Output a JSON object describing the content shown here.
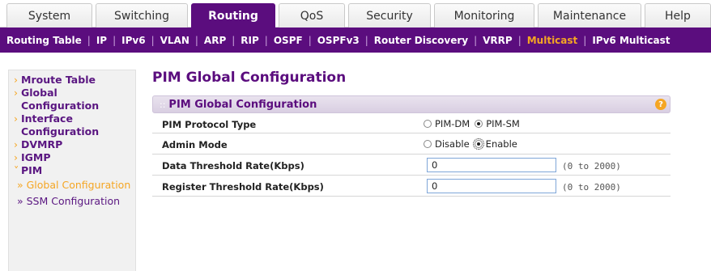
{
  "top_tabs": [
    {
      "label": "System",
      "active": false
    },
    {
      "label": "Switching",
      "active": false
    },
    {
      "label": "Routing",
      "active": true
    },
    {
      "label": "QoS",
      "active": false
    },
    {
      "label": "Security",
      "active": false
    },
    {
      "label": "Monitoring",
      "active": false
    },
    {
      "label": "Maintenance",
      "active": false
    },
    {
      "label": "Help",
      "active": false
    }
  ],
  "sub_nav": [
    {
      "label": "Routing Table",
      "active": false
    },
    {
      "label": "IP",
      "active": false
    },
    {
      "label": "IPv6",
      "active": false
    },
    {
      "label": "VLAN",
      "active": false
    },
    {
      "label": "ARP",
      "active": false
    },
    {
      "label": "RIP",
      "active": false
    },
    {
      "label": "OSPF",
      "active": false
    },
    {
      "label": "OSPFv3",
      "active": false
    },
    {
      "label": "Router Discovery",
      "active": false
    },
    {
      "label": "VRRP",
      "active": false
    },
    {
      "label": "Multicast",
      "active": true
    },
    {
      "label": "IPv6 Multicast",
      "active": false
    }
  ],
  "sidebar": {
    "items": [
      {
        "bullet": "›",
        "label": "Mroute Table"
      },
      {
        "bullet": "›",
        "label": "Global Configuration"
      },
      {
        "bullet": "›",
        "label": "Interface Configuration"
      },
      {
        "bullet": "›",
        "label": "DVMRP"
      },
      {
        "bullet": "›",
        "label": "IGMP"
      },
      {
        "bullet": "˅",
        "label": "PIM"
      }
    ],
    "sub_items": [
      {
        "label": "» Global Configuration",
        "active": true
      },
      {
        "label": "» SSM Configuration",
        "active": false
      }
    ]
  },
  "main": {
    "page_title": "PIM Global Configuration",
    "panel_title": "PIM Global Configuration",
    "help_icon": "?",
    "fields": {
      "protocol_type": {
        "label": "PIM Protocol Type",
        "options": [
          "PIM-DM",
          "PIM-SM"
        ],
        "selected": "PIM-SM"
      },
      "admin_mode": {
        "label": "Admin Mode",
        "options": [
          "Disable",
          "Enable"
        ],
        "selected": "Enable"
      },
      "data_threshold": {
        "label": "Data Threshold Rate(Kbps)",
        "value": "0",
        "range": "(0 to 2000)"
      },
      "register_threshold": {
        "label": "Register Threshold Rate(Kbps)",
        "value": "0",
        "range": "(0 to 2000)"
      }
    }
  },
  "colors": {
    "brand_purple": "#5b0d7e",
    "accent_orange": "#f5a623"
  }
}
